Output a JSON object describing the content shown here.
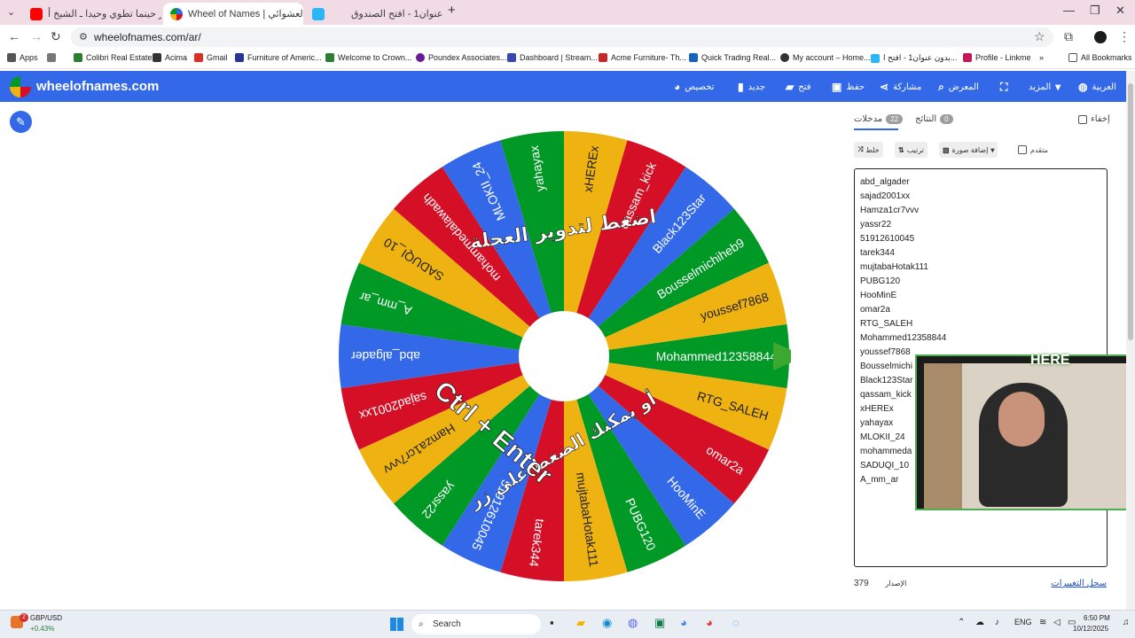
{
  "browser": {
    "tabs": [
      {
        "title": "تذكر حينما تطوي وحيدا ـ الشيخ أ...",
        "icon": "youtube-icon",
        "color": "#ff0000"
      },
      {
        "title": "Wheel of Names | مسم العشوائي",
        "icon": "wheel-icon",
        "color": "#3369e8"
      },
      {
        "title": "بدون عنوان1 - افتح الصندوق",
        "icon": "box-icon",
        "color": "#29b6f6"
      }
    ],
    "url": "wheelofnames.com/ar/",
    "bookmarks": [
      {
        "label": "Apps",
        "color": "#555555"
      },
      {
        "label": "Colibri Real Estate",
        "color": "#2e7d32"
      },
      {
        "label": "Acima",
        "color": "#333333"
      },
      {
        "label": "Gmail",
        "color": "#d93025"
      },
      {
        "label": "Furniture of Americ...",
        "color": "#283593"
      },
      {
        "label": "Welcome to Crown...",
        "color": "#2e7d32"
      },
      {
        "label": "Poundex Associates...",
        "color": "#6a1b9a"
      },
      {
        "label": "Dashboard | Stream...",
        "color": "#3949ab"
      },
      {
        "label": "Acme Furniture- Th...",
        "color": "#c62828"
      },
      {
        "label": "Quick Trading Real...",
        "color": "#1565c0"
      },
      {
        "label": "My account – Home...",
        "color": "#333333"
      },
      {
        "label": "بدون عنوان1 - افتح ا...",
        "color": "#29b6f6"
      },
      {
        "label": "Profile - Linkme",
        "color": "#c2185b"
      }
    ],
    "all_bookmarks": "All Bookmarks"
  },
  "app": {
    "brand": "wheelofnames.com",
    "menu": [
      {
        "label": "العربية",
        "icon": "globe-icon"
      },
      {
        "label": "المزيد",
        "icon": "chevron-down-icon"
      },
      {
        "label": "",
        "icon": "fullscreen-icon"
      },
      {
        "label": "المعرض",
        "icon": "search-icon"
      },
      {
        "label": "مشاركة",
        "icon": "share-icon"
      },
      {
        "label": "حفظ",
        "icon": "save-icon"
      },
      {
        "label": "فتح",
        "icon": "folder-icon"
      },
      {
        "label": "جديد",
        "icon": "file-icon"
      },
      {
        "label": "تخصيص",
        "icon": "palette-icon"
      }
    ]
  },
  "wheel": {
    "center_text_top": "اضغط لتدوير العجلة",
    "center_text_bottom": "أو يمكنك الضغط على زر",
    "shortcut": "Ctrl + Enter",
    "colors": [
      "#009925",
      "#eeb211",
      "#d50f25",
      "#3369e8"
    ],
    "entries": [
      "Mohammed12358844",
      "RTG_SALEH",
      "omar2a",
      "HooMinE",
      "PUBG120",
      "mujtabaHotak111",
      "tarek344",
      "51912610045",
      "yassr22",
      "Hamza1cr7vvv",
      "sajad2001xx",
      "abd_algader",
      "A_mm_ar",
      "SADUQI_10",
      "mohammedalawadh",
      "MLOKII_24",
      "yahayax",
      "xHEREx",
      "qassam_kick",
      "Black123Star",
      "Bousselmichiheb9",
      "youssef7868"
    ]
  },
  "panel": {
    "hide_label": "إخفاء",
    "results_label": "النتائج",
    "results_count": "0",
    "entries_label": "مدخلات",
    "entries_count": "22",
    "shuffle_label": "خلط",
    "sort_label": "ترتيب",
    "add_image_label": "إضافة صورة",
    "advanced_label": "متقدم",
    "entries_list": [
      "abd_algader",
      "sajad2001xx",
      "Hamza1cr7vvv",
      "yassr22",
      "51912610045",
      "tarek344",
      "mujtabaHotak111",
      "PUBG120",
      "HooMinE",
      "omar2a",
      "RTG_SALEH",
      "Mohammed12358844",
      "youssef7868",
      "Bousselmichi",
      "Black123Star",
      "qassam_kick",
      "xHEREx",
      "yahayax",
      "MLOKII_24",
      "mohammeda",
      "SADUQI_10",
      "A_mm_ar"
    ],
    "version_label": "الإصدار",
    "version": "379",
    "changelog": "سجل التغييرات"
  },
  "webcam": {
    "label": "HERE"
  },
  "taskbar": {
    "weather_title": "GBP/USD",
    "weather_value": "+0.43%",
    "weather_badge": "2",
    "search": "Search",
    "lang": "ENG",
    "time": "6:50 PM",
    "date": "10/12/2025"
  }
}
